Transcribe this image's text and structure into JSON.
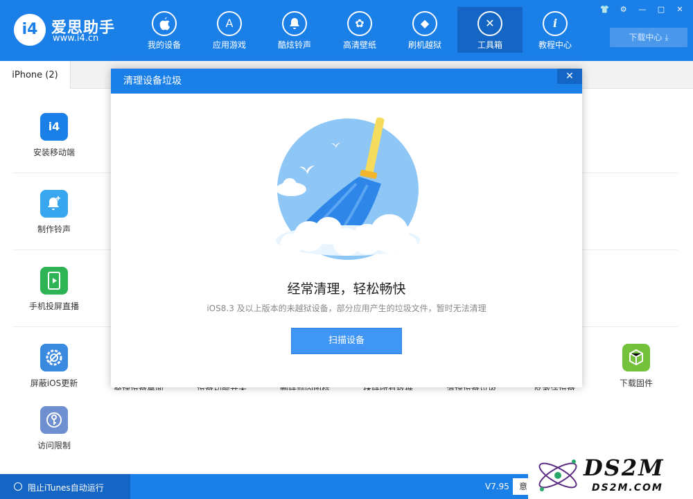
{
  "app": {
    "logo_mark": "i4",
    "name": "爱思助手",
    "url": "www.i4.cn"
  },
  "nav": [
    {
      "label": "我的设备",
      "icon": "apple-icon",
      "glyph": ""
    },
    {
      "label": "应用游戏",
      "icon": "appstore-icon",
      "glyph": "A"
    },
    {
      "label": "酷炫铃声",
      "icon": "bell-icon",
      "glyph": "♪"
    },
    {
      "label": "高清壁纸",
      "icon": "flower-icon",
      "glyph": "✿"
    },
    {
      "label": "刷机越狱",
      "icon": "dropbox-icon",
      "glyph": "◆"
    },
    {
      "label": "工具箱",
      "icon": "tools-icon",
      "glyph": "✕"
    },
    {
      "label": "教程中心",
      "icon": "info-icon",
      "glyph": "i"
    }
  ],
  "window_controls": [
    "shirt-icon",
    "gear-icon",
    "minimize-icon",
    "maximize-icon",
    "close-icon"
  ],
  "window_glyphs": [
    "👕",
    "⚙",
    "—",
    "□",
    "✕"
  ],
  "download_center": {
    "label": "下载中心",
    "icon": "download-icon"
  },
  "tab": {
    "label": "iPhone (2)"
  },
  "tools": [
    {
      "label": "安装移动端",
      "icon": "i4-app-icon",
      "color": "#1b7fe8",
      "glyph": "i4"
    },
    {
      "label": "制作铃声",
      "icon": "bell-plus-icon",
      "color": "#39a7f0",
      "glyph": "♪"
    },
    {
      "label": "手机投屏直播",
      "icon": "screen-cast-icon",
      "color": "#2fb455",
      "glyph": "▶"
    },
    {
      "label": "屏蔽iOS更新",
      "icon": "gear-block-icon",
      "color": "#3a8ae0",
      "glyph": "⚙"
    },
    {
      "label": "访问限制",
      "icon": "key-icon",
      "color": "#6e8fd0",
      "glyph": "⚿"
    },
    {
      "label": "下载固件",
      "icon": "cube-icon",
      "color": "#74c23c",
      "glyph": "⬢"
    }
  ],
  "hidden_tools": [
    "整理设备桌面",
    "设备功能开关",
    "删除顽固图标",
    "抹除所有数据",
    "清理设备垃圾",
    "反激活设备"
  ],
  "modal": {
    "title": "清理设备垃圾",
    "headline": "经常清理，轻松畅快",
    "description": "iOS8.3 及以上版本的未越狱设备，部分应用产生的垃圾文件，暂时无法清理",
    "scan_button": "扫描设备",
    "close_glyph": "✕"
  },
  "status": {
    "itunes_toggle": "阻止iTunes自动运行",
    "version": "V7.95",
    "feedback_btn": "意"
  },
  "watermark": {
    "big": "DS2M",
    "small": "DS2M.COM"
  },
  "colors": {
    "primary": "#1b7fe8",
    "primary_dark": "#1566c4",
    "button": "#3f96f5"
  }
}
